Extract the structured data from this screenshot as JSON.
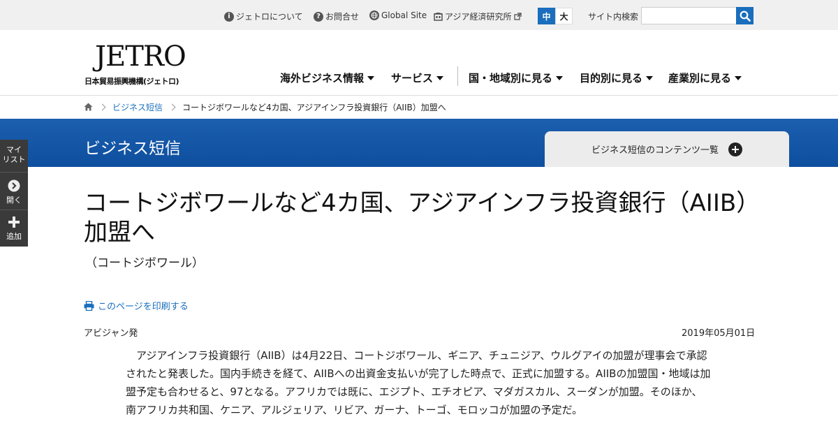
{
  "topbar": {
    "links": [
      {
        "label": "ジェトロについて",
        "icon": "info-icon"
      },
      {
        "label": "お問合せ",
        "icon": "question-icon"
      },
      {
        "label": "Global Site",
        "icon": "globe-icon"
      },
      {
        "label": "アジア経済研究所",
        "icon": "building-icon"
      }
    ],
    "font_size": {
      "mid": "中",
      "big": "大"
    },
    "search_label": "サイト内検索",
    "search_placeholder": ""
  },
  "logo": {
    "mark": "JETRO",
    "sub": "日本貿易振興機構(ジェトロ)"
  },
  "nav": [
    "海外ビジネス情報",
    "サービス",
    "国・地域別に見る",
    "目的別に見る",
    "産業別に見る"
  ],
  "breadcrumb": {
    "section": "ビジネス短信",
    "current": "コートジボワールなど4カ国、アジアインフラ投資銀行（AIIB）加盟へ"
  },
  "band": {
    "title": "ビジネス短信",
    "contents_tab": "ビジネス短信のコンテンツ一覧"
  },
  "side": {
    "mylist": "マイ\nリスト",
    "open": "開く",
    "add": "追加"
  },
  "article": {
    "headline": "コートジボワールなど4カ国、アジアインフラ投資銀行（AIIB）加盟へ",
    "country": "（コートジボワール）",
    "print": "このページを印刷する",
    "origin": "アビジャン発",
    "date": "2019年05月01日",
    "body": "アジアインフラ投資銀行（AIIB）は4月22日、コートジボワール、ギニア、チュニジア、ウルグアイの加盟が理事会で承認されたと発表した。国内手続きを経て、AIIBへの出資金支払いが完了した時点で、正式に加盟する。AIIBの加盟国・地域は加盟予定も合わせると、97となる。アフリカでは既に、エジプト、エチオピア、マダガスカル、スーダンが加盟。そのほか、南アフリカ共和国、ケニア、アルジェリア、リビア、ガーナ、トーゴ、モロッコが加盟の予定だ。"
  },
  "colors": {
    "brand_blue": "#1a6ebd",
    "band_blue": "#0e4f9f",
    "topbar_bg": "#f0f0f0"
  }
}
